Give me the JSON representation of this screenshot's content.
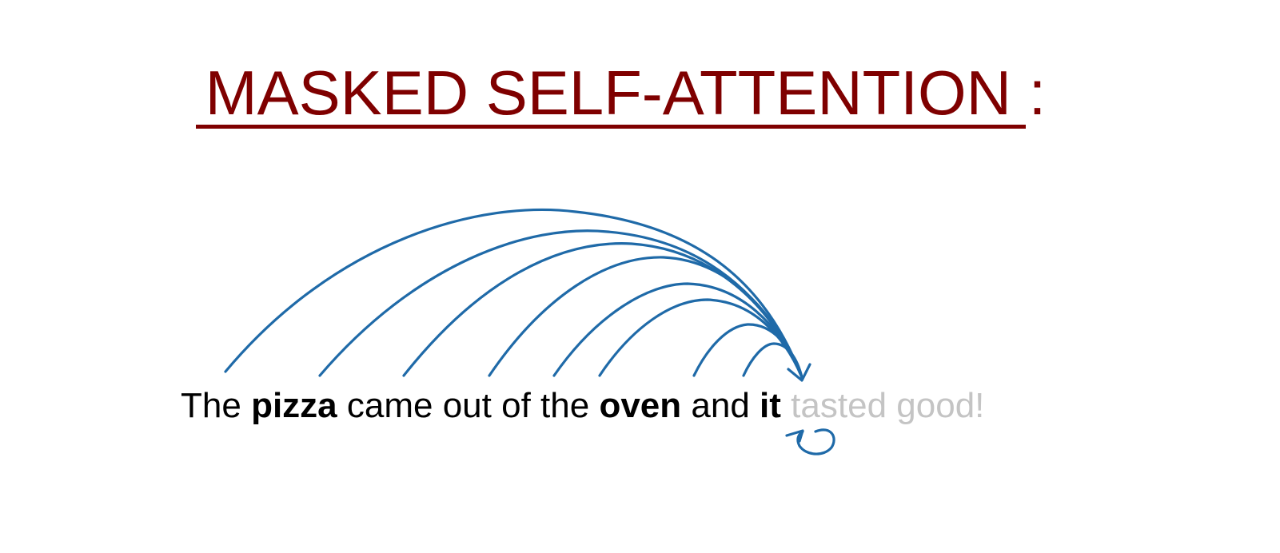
{
  "title": "MASKED SELF-ATTENTION :",
  "colors": {
    "title": "#7f0000",
    "arrows": "#1f6aa8",
    "text": "#000000",
    "masked_text": "#c4c4c4"
  },
  "sentence": {
    "tokens": [
      {
        "text": "The",
        "bold": false,
        "masked": false
      },
      {
        "text": "pizza",
        "bold": true,
        "masked": false
      },
      {
        "text": "came",
        "bold": false,
        "masked": false
      },
      {
        "text": "out",
        "bold": false,
        "masked": false
      },
      {
        "text": "of",
        "bold": false,
        "masked": false
      },
      {
        "text": "the",
        "bold": false,
        "masked": false
      },
      {
        "text": "oven",
        "bold": true,
        "masked": false
      },
      {
        "text": "and",
        "bold": false,
        "masked": false
      },
      {
        "text": "it",
        "bold": true,
        "masked": false
      },
      {
        "text": "tasted",
        "bold": false,
        "masked": true
      },
      {
        "text": "good!",
        "bold": false,
        "masked": true
      }
    ]
  },
  "attention": {
    "target_token": "it",
    "source_tokens": [
      "The",
      "pizza",
      "came",
      "out",
      "of",
      "the",
      "oven",
      "and",
      "it"
    ],
    "self_loop_token": "it"
  }
}
